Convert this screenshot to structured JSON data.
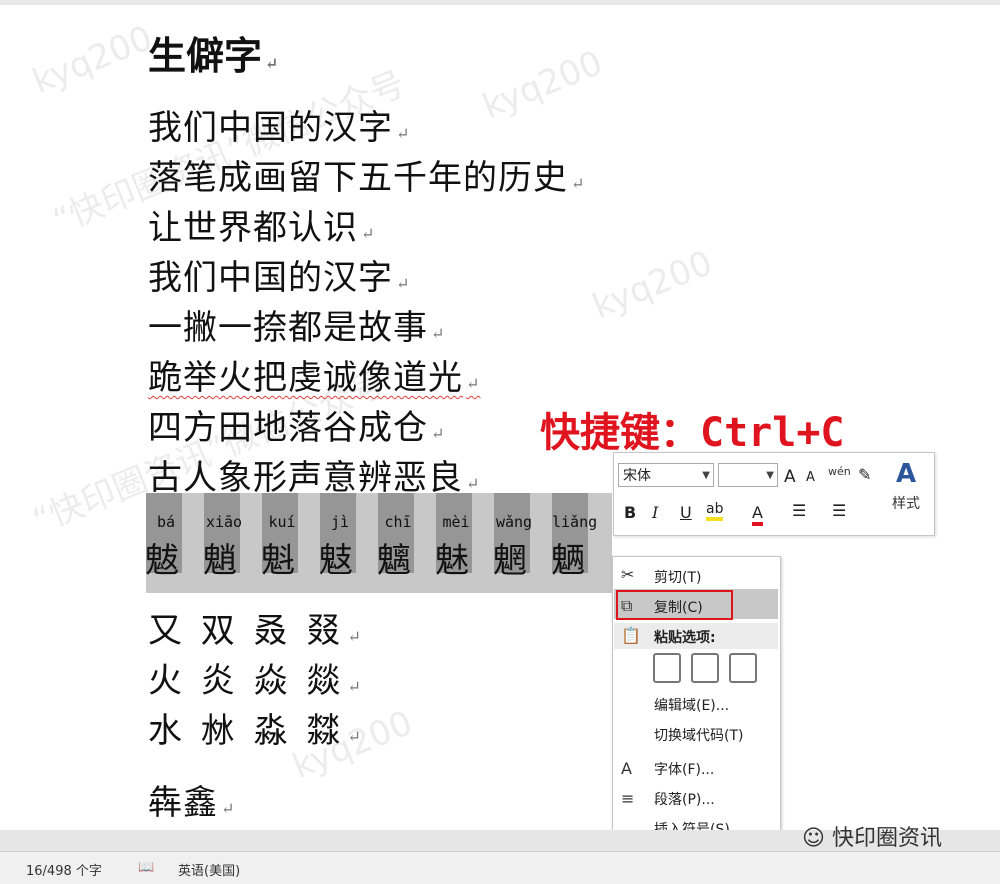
{
  "document": {
    "title": "生僻字",
    "lines": [
      "我们中国的汉字",
      "落笔成画留下五千年的历史",
      "让世界都认识",
      "我们中国的汉字",
      "一撇一捺都是故事",
      "跪举火把虔诚像道光",
      "四方田地落谷成仓",
      "古人象形声意辨恶良"
    ],
    "paragraph_mark": "↵",
    "selected_chars": [
      {
        "pinyin": "bá",
        "char": "魃"
      },
      {
        "pinyin": "xiāo",
        "char": "魈"
      },
      {
        "pinyin": "kuí",
        "char": "魁"
      },
      {
        "pinyin": "jì",
        "char": "鬾"
      },
      {
        "pinyin": "chī",
        "char": "魑"
      },
      {
        "pinyin": "mèi",
        "char": "魅"
      },
      {
        "pinyin": "wǎng",
        "char": "魍"
      },
      {
        "pinyin": "liǎng",
        "char": "魉"
      }
    ],
    "grid_lines": [
      "又 双 叒 叕",
      "火 炎 焱 燚",
      "水 沝 淼 㵘"
    ],
    "last_line": "犇鑫"
  },
  "annotation": {
    "shortcut_hint": "快捷键：Ctrl+C",
    "hint_color": "#e0141e"
  },
  "mini_toolbar": {
    "font_name": "宋体",
    "font_size": "",
    "grow_font": "A",
    "shrink_font": "A",
    "bold": "B",
    "italic": "I",
    "underline": "U",
    "font_color": "A",
    "styles_label": "样式"
  },
  "context_menu": {
    "items": [
      {
        "label": "剪切(T)",
        "icon": "scissors-icon"
      },
      {
        "label": "复制(C)",
        "icon": "copy-icon"
      },
      {
        "label": "粘贴选项:",
        "icon": "paste-icon"
      },
      {
        "label": "编辑域(E)...",
        "icon": ""
      },
      {
        "label": "切换域代码(T)",
        "icon": ""
      },
      {
        "label": "字体(F)...",
        "icon": "font-icon"
      },
      {
        "label": "段落(P)...",
        "icon": "paragraph-icon"
      },
      {
        "label": "插入符号(S)",
        "icon": ""
      }
    ]
  },
  "status_bar": {
    "word_count": "16/498 个字",
    "language": "英语(美国)"
  },
  "watermark": {
    "text1": "kyq200",
    "text2": "“快印圈资讯”微信公众号",
    "brand": "快印圈资讯"
  }
}
